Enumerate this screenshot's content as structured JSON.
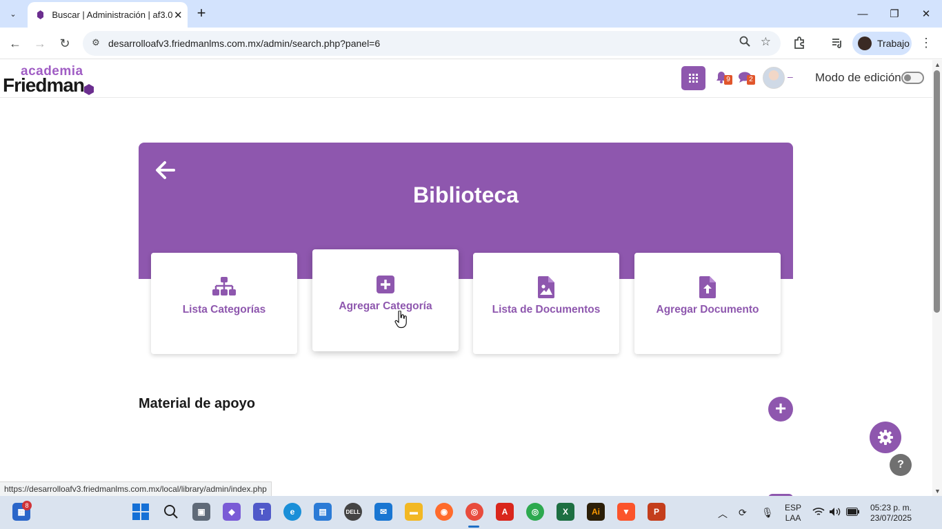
{
  "browser": {
    "tab_title": "Buscar | Administración | af3.0",
    "url": "desarrolloafv3.friedmanlms.com.mx/admin/search.php?panel=6",
    "profile_label": "Trabajo",
    "status_url": "https://desarrolloafv3.friedmanlms.com.mx/local/library/admin/index.php"
  },
  "site": {
    "logo_small": "academia",
    "logo_big": "Friedman",
    "notifications_count": "9",
    "messages_count": "2",
    "edit_mode_label": "Modo de edición",
    "edit_mode_on": false
  },
  "library": {
    "title": "Biblioteca",
    "cards": [
      {
        "label": "Lista Categorías",
        "icon": "sitemap-icon"
      },
      {
        "label": "Agregar Categoría",
        "icon": "plus-square-icon"
      },
      {
        "label": "Lista de Documentos",
        "icon": "file-image-icon"
      },
      {
        "label": "Agregar Documento",
        "icon": "file-upload-icon"
      }
    ],
    "section_title": "Material de apoyo"
  },
  "taskbar": {
    "start_badge": "8",
    "language": "ESP",
    "language_sub": "LAA",
    "time": "05:23 p. m.",
    "date": "23/07/2025"
  },
  "colors": {
    "brand": "#8e57ae",
    "chrome_tab_strip": "#d3e3fd",
    "taskbar": "#dae3ef"
  }
}
